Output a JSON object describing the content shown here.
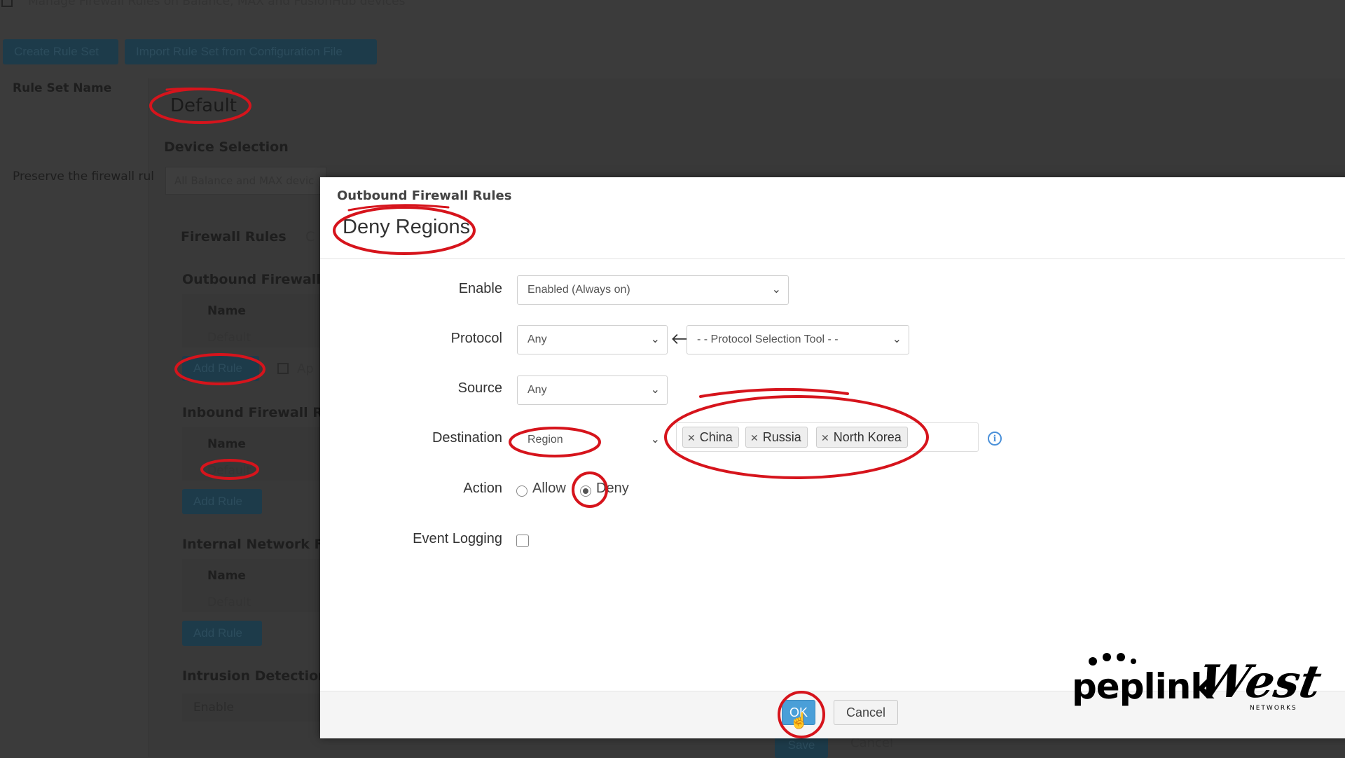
{
  "background": {
    "top_checkbox_label": "Manage Firewall Rules on Balance, MAX and FusionHub devices",
    "create_rule_set_button": "Create Rule Set",
    "import_button": "Import Rule Set from Configuration File",
    "rule_set_name_label": "Rule Set Name",
    "rule_set_name_value": "Default",
    "device_selection_heading": "Device Selection",
    "preserve_label": "Preserve the firewall rul",
    "device_selection_value": "All Balance and MAX devic",
    "tab_firewall_rules": "Firewall Rules",
    "tab_other": "C",
    "outbound_heading": "Outbound Firewall",
    "outbound_name_header": "Name",
    "outbound_default": "Default",
    "outbound_add_rule": "Add Rule",
    "apply_label": "Ap",
    "inbound_heading": "Inbound Firewall Ru",
    "inbound_name_header": "Name",
    "inbound_default": "Default",
    "inbound_add_rule": "Add Rule",
    "internal_heading": "Internal Network Fi",
    "internal_name_header": "Name",
    "internal_default": "Default",
    "internal_add_rule": "Add Rule",
    "intrusion_heading": "Intrusion Detection",
    "intrusion_enable": "Enable",
    "bottom_save": "Save",
    "bottom_cancel": "Cancel"
  },
  "dialog": {
    "kicker": "Outbound Firewall Rules",
    "title": "Deny Regions",
    "fields": {
      "enable_label": "Enable",
      "enable_value": "Enabled (Always on)",
      "protocol_label": "Protocol",
      "protocol_value": "Any",
      "protocol_tool_value": "- - Protocol Selection Tool - -",
      "source_label": "Source",
      "source_value": "Any",
      "destination_label": "Destination",
      "destination_value": "Region",
      "destination_regions": [
        "China",
        "Russia",
        "North Korea"
      ],
      "action_label": "Action",
      "action_allow": "Allow",
      "action_deny": "Deny",
      "action_selected": "Deny",
      "event_logging_label": "Event Logging",
      "event_logging_checked": false
    },
    "ok_button": "OK",
    "cancel_button": "Cancel"
  },
  "icons": {
    "chevron": "chevron-down-icon",
    "arrow": "arrow-left-icon",
    "info": "info-icon",
    "remove": "remove-tag-icon"
  },
  "branding": {
    "peplink": "peplink",
    "west": "West",
    "west_sub": "NETWORKS"
  },
  "colors": {
    "annotation_red": "#d6141c",
    "ok_blue": "#4a9fd8",
    "info_blue": "#4a90d9"
  }
}
